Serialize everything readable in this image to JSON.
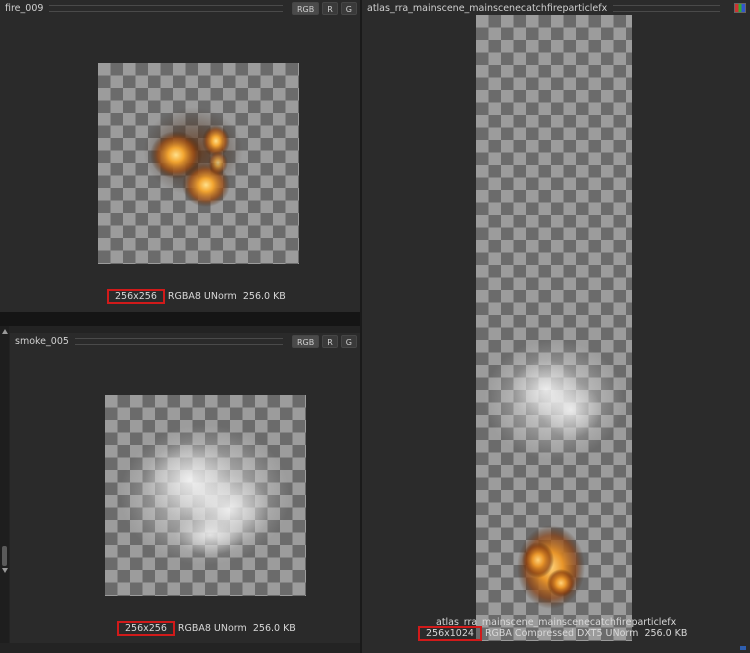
{
  "panels": {
    "fire": {
      "title": "fire_009",
      "channels": [
        "RGB",
        "R",
        "G"
      ],
      "dims": "256x256",
      "format": "RGBA8 UNorm",
      "size": "256.0 KB"
    },
    "smoke": {
      "title": "smoke_005",
      "channels": [
        "RGB",
        "R",
        "G"
      ],
      "dims": "256x256",
      "format": "RGBA8 UNorm",
      "size": "256.0 KB"
    },
    "atlas": {
      "title": "atlas_rra_mainscene_mainscenecatchfireparticlefx",
      "caption": "atlas_rra_mainscene_mainscenecatchfireparticlefx",
      "dims": "256x1024",
      "format": "RGBA Compressed DXT5 UNorm",
      "size": "256.0 KB"
    }
  },
  "colors": {
    "highlight": "#d11a1a",
    "background": "#232323"
  }
}
